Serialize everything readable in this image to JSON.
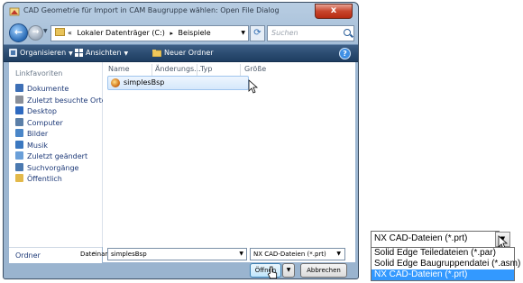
{
  "window": {
    "title": "CAD Geometrie für Import in CAM Baugruppe wählen: Open File Dialog",
    "close_label": "x"
  },
  "address_bar": {
    "prefix": "«",
    "path": [
      "Lokaler Datenträger (C:)",
      "Beispiele"
    ],
    "separator": "▸",
    "search_placeholder": "Suchen"
  },
  "toolbar": {
    "organize": "Organisieren",
    "views": "Ansichten",
    "new_folder": "Neuer Ordner",
    "help": "?"
  },
  "nav": {
    "heading": "Linkfavoriten",
    "items": [
      {
        "label": "Dokumente",
        "icon": "documents-icon",
        "color": "#3d6fb6"
      },
      {
        "label": "Zuletzt besuchte Orte",
        "icon": "recent-places-icon",
        "color": "#8a8f99"
      },
      {
        "label": "Desktop",
        "icon": "desktop-icon",
        "color": "#2f6ac0"
      },
      {
        "label": "Computer",
        "icon": "computer-icon",
        "color": "#5b7fa8"
      },
      {
        "label": "Bilder",
        "icon": "pictures-icon",
        "color": "#4a86c8"
      },
      {
        "label": "Musik",
        "icon": "music-icon",
        "color": "#3b78c0"
      },
      {
        "label": "Zuletzt geändert",
        "icon": "recently-changed-icon",
        "color": "#6a9fd8"
      },
      {
        "label": "Suchvorgänge",
        "icon": "searches-icon",
        "color": "#4b79b0"
      },
      {
        "label": "Öffentlich",
        "icon": "public-folder-icon",
        "color": "#e3b94a"
      }
    ],
    "folders_label": "Ordner",
    "folders_caret": "^"
  },
  "columns": [
    "Name",
    "Änderungs...",
    "Typ",
    "Größe"
  ],
  "files": [
    {
      "name": "simplesBsp"
    }
  ],
  "bottom": {
    "filename_label": "Dateiname:",
    "filename_value": "simplesBsp",
    "filetype_value": "NX CAD-Dateien (*.prt)",
    "open_label": "Öffnen",
    "cancel_label": "Abbrechen"
  },
  "dropdown": {
    "selected": "NX CAD-Dateien (*.prt)",
    "options": [
      "Solid Edge Teiledateien (*.par)",
      "Solid Edge Baugruppendatei (*.asm)",
      "NX CAD-Dateien (*.prt)"
    ],
    "highlighted_index": 2
  }
}
